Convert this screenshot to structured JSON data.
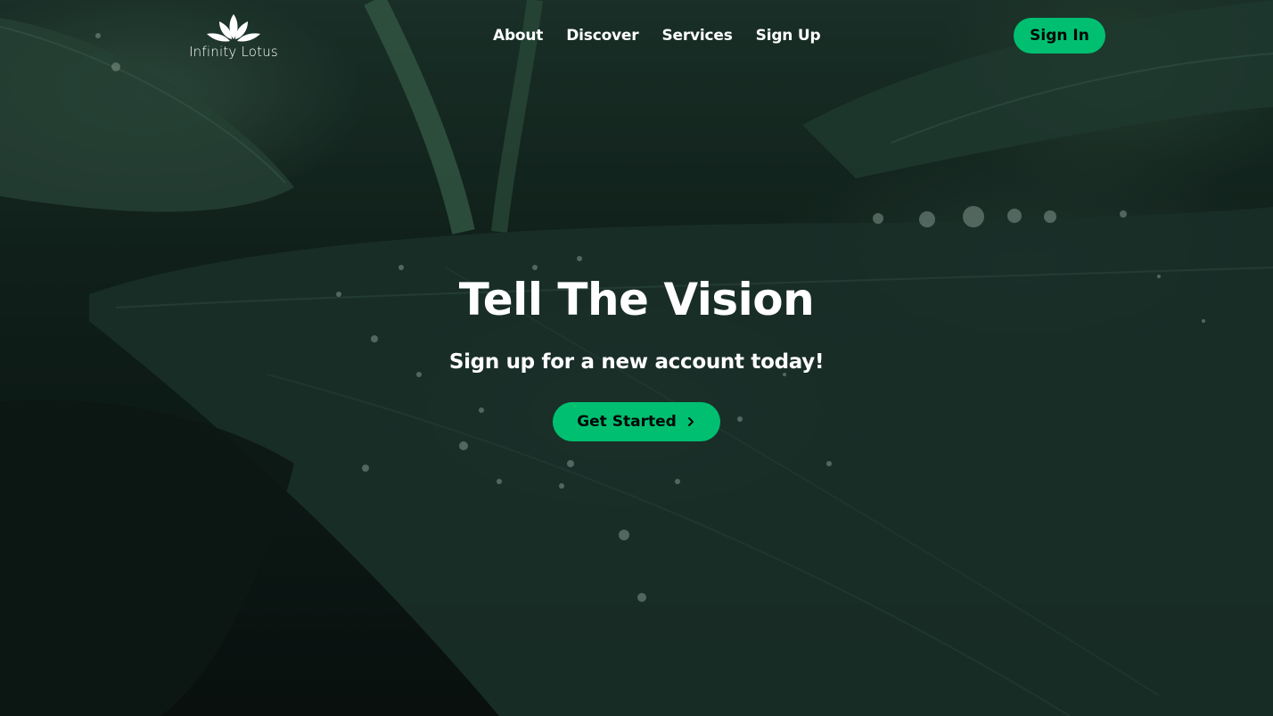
{
  "brand": {
    "name": "Infinity Lotus",
    "logo_icon": "lotus-icon"
  },
  "nav": {
    "items": [
      {
        "label": "About"
      },
      {
        "label": "Discover"
      },
      {
        "label": "Services"
      },
      {
        "label": "Sign Up"
      }
    ],
    "signin_label": "Sign In"
  },
  "hero": {
    "title": "Tell The Vision",
    "subtitle": "Sign up for a new account today!",
    "cta_label": "Get Started",
    "cta_icon": "chevron-right-icon",
    "background": "dark green leaves with water droplets"
  },
  "colors": {
    "accent": "#01bf71",
    "button_text": "#010606",
    "text": "#ffffff"
  }
}
